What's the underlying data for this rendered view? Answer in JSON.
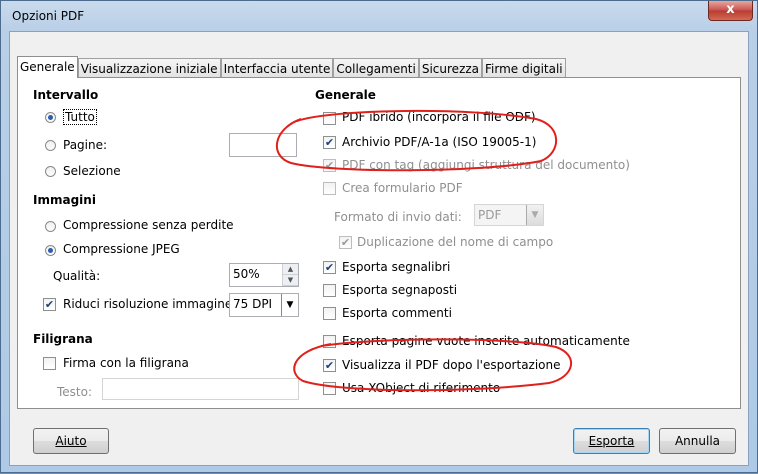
{
  "window": {
    "title": "Opzioni PDF",
    "close_glyph": "x"
  },
  "tabs": [
    {
      "label": "Generale",
      "active": true
    },
    {
      "label": "Visualizzazione iniziale",
      "active": false
    },
    {
      "label": "Interfaccia utente",
      "active": false
    },
    {
      "label": "Collegamenti",
      "active": false
    },
    {
      "label": "Sicurezza",
      "active": false
    },
    {
      "label": "Firme digitali",
      "active": false
    }
  ],
  "intervallo": {
    "title": "Intervallo",
    "tutto": "Tutto",
    "pagine": "Pagine:",
    "selezione": "Selezione",
    "selected": "Tutto",
    "pagine_value": ""
  },
  "immagini": {
    "title": "Immagini",
    "lossless": "Compressione senza perdite",
    "jpeg": "Compressione JPEG",
    "selected": "Compressione JPEG",
    "qualita_label": "Qualità:",
    "qualita_value": "50%",
    "riduci_label": "Riduci risoluzione immagine",
    "riduci_checked": true,
    "dpi_value": "75 DPI"
  },
  "filigrana": {
    "title": "Filigrana",
    "firma_label": "Firma con la filigrana",
    "firma_checked": false,
    "testo_label": "Testo:",
    "testo_value": ""
  },
  "generale": {
    "title": "Generale",
    "pdf_ibrido": "PDF ibrido (incorpora il file ODF)",
    "archivio": "Archivio PDF/A-1a (ISO 19005-1)",
    "pdf_tag": "PDF con tag (aggiungi struttura del documento)",
    "crea_form": "Crea formulario PDF",
    "formato_label": "Formato di invio dati:",
    "formato_value": "PDF",
    "duplicazione": "Duplicazione del nome di campo",
    "segnalibri": "Esporta segnalibri",
    "segnaposti": "Esporta segnaposti",
    "commenti": "Esporta commenti",
    "pagine_vuote": "Esporta pagine vuote inserite automaticamente",
    "visualizza": "Visualizza il PDF dopo l'esportazione",
    "xobject": "Usa XObject di riferimento"
  },
  "buttons": {
    "aiuto": "Aiuto",
    "esporta": "Esporta",
    "annulla": "Annulla"
  },
  "colors": {
    "annotation": "#e0201b",
    "check": "#1e3f7a",
    "radio": "#2a5db0"
  },
  "icons": {
    "check": "✔",
    "spin_up": "▲",
    "spin_down": "▼",
    "dropdown": "▼"
  }
}
